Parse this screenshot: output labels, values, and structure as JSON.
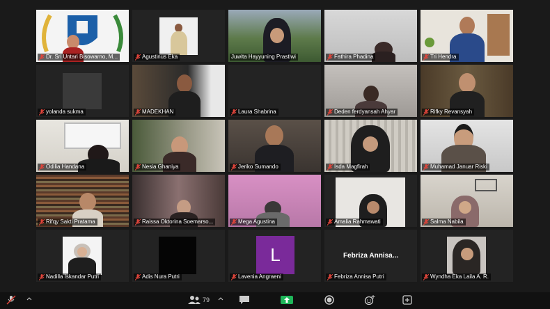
{
  "participants": [
    {
      "name": "Dr. Sri Untari Bisowarno, M..."
    },
    {
      "name": "Agustinus Eka"
    },
    {
      "name": "Juwita Hayyuning Prastiwi"
    },
    {
      "name": "Fathira Phadina"
    },
    {
      "name": "Tri Hendra"
    },
    {
      "name": "yolanda sukma"
    },
    {
      "name": "MADEKHAN"
    },
    {
      "name": "Laura Shabrina"
    },
    {
      "name": "Deden ferdyansah Ahyar"
    },
    {
      "name": "Rifky Revansyah"
    },
    {
      "name": "Odilia Handana"
    },
    {
      "name": "Nesia Ghaniya"
    },
    {
      "name": "Jeriko Sumando"
    },
    {
      "name": "Isda Magfirah"
    },
    {
      "name": "Muhamad Januar Riski"
    },
    {
      "name": "Rifqy Sakti Pratama"
    },
    {
      "name": "Raissa Oktorina Soemarso..."
    },
    {
      "name": "Mega Agustina"
    },
    {
      "name": "Amalia Rahmawati"
    },
    {
      "name": "Salma Nabila"
    },
    {
      "name": "Nadilla Iskandar Putri"
    },
    {
      "name": "Adis Nura Putri"
    },
    {
      "name": "Lavenia Angraeni",
      "avatar_letter": "L"
    },
    {
      "name": "Febriza Annisa Putri",
      "name_display": "Febriza  Annisa..."
    },
    {
      "name": "Wyndha Eka Laila A. R."
    }
  ],
  "toolbar": {
    "participants_count": "79",
    "icons": [
      "mic-muted-icon",
      "participants-icon",
      "chat-icon",
      "share-screen-icon",
      "record-icon",
      "reactions-icon",
      "apps-icon"
    ]
  },
  "colors": {
    "active_speaker": "#d6df3a",
    "muted": "#e0453b",
    "share": "#1fb65a"
  }
}
